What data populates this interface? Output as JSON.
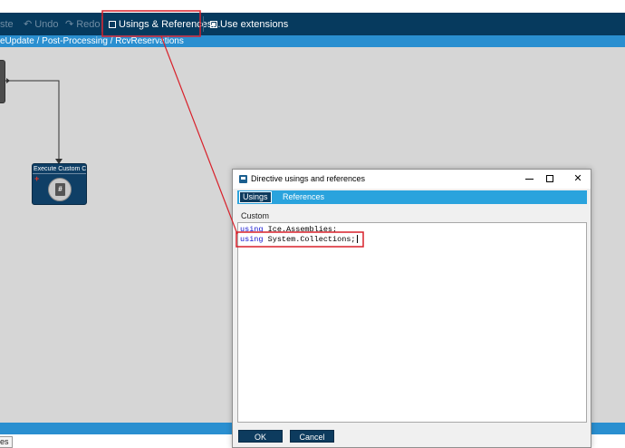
{
  "toolbar": {
    "paste_label": "ste",
    "undo_label": "Undo",
    "redo_label": "Redo",
    "usings_label": "Usings & References...",
    "extensions_label": "Use extensions"
  },
  "breadcrumb": {
    "path": "eUpdate / Post-Processing / RcvReservations"
  },
  "canvas": {
    "exec_node_title": "Execute Custom Co",
    "exec_node_badge": "+",
    "exec_node_glyph": "#"
  },
  "bottom": {
    "tab_label": "es"
  },
  "dialog": {
    "title": "Directive usings and references",
    "tabs": [
      {
        "label": "Usings",
        "active": true
      },
      {
        "label": "References",
        "active": false
      }
    ],
    "section_label": "Custom",
    "code_lines": [
      {
        "keyword": "using",
        "rest": " Ice.Assemblies;"
      },
      {
        "keyword": "using",
        "rest": " System.Collections;"
      }
    ],
    "ok_label": "OK",
    "cancel_label": "Cancel"
  },
  "annotation": {
    "color": "#d8202a"
  },
  "colors": {
    "toolbar_bg": "#063a5e",
    "accent_blue": "#2a8fd0",
    "canvas_bg": "#d6d6d6",
    "keyword": "#1010d0"
  }
}
